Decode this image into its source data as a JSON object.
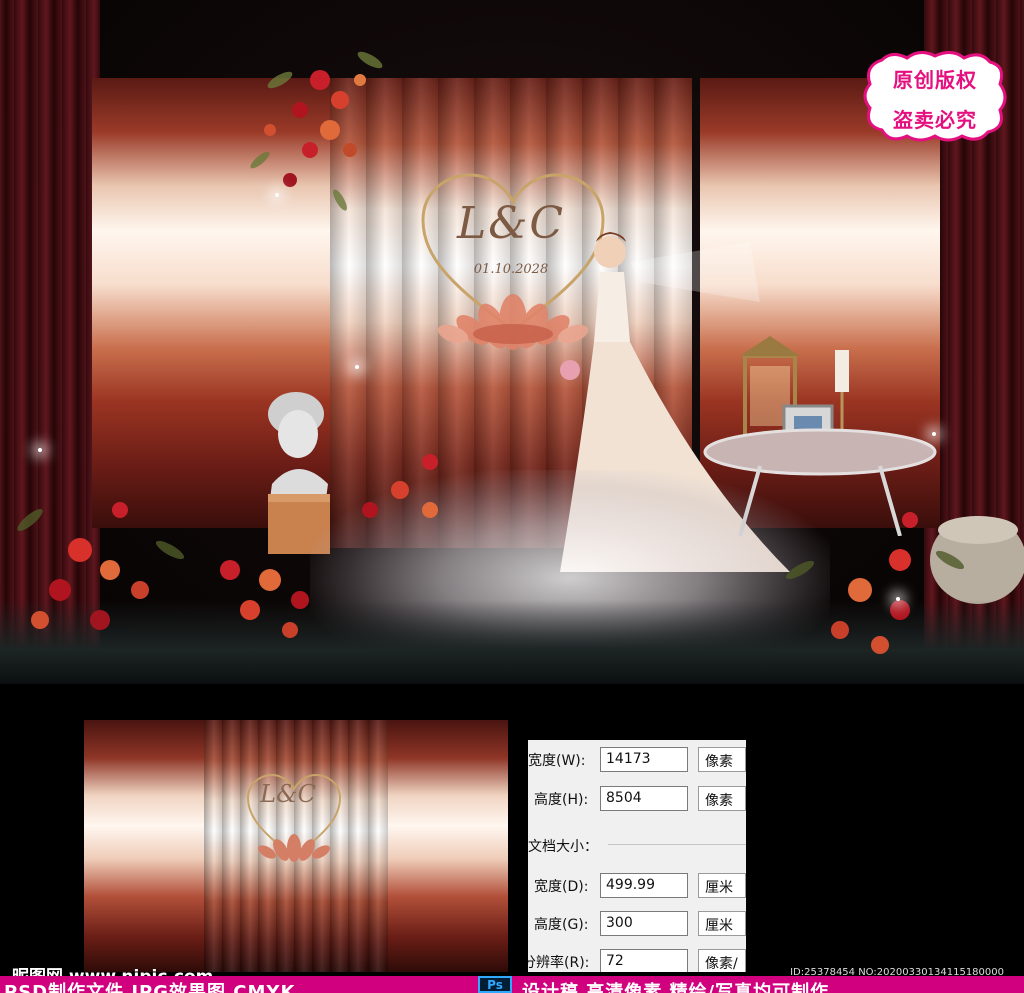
{
  "scene": {
    "monogram": "L&C",
    "date": "01.10.2028",
    "badge": {
      "line1": "原创版权",
      "line2": "盗卖必究",
      "color": "#e5107f"
    }
  },
  "thumbnail": {
    "monogram": "L&C"
  },
  "image_size_dialog": {
    "width_px": {
      "label": "宽度(W):",
      "value": "14173",
      "unit": "像素"
    },
    "height_px": {
      "label": "高度(H):",
      "value": "8504",
      "unit": "像素"
    },
    "doc_size_label": "文档大小：",
    "width_doc": {
      "label": "宽度(D):",
      "value": "499.99",
      "unit": "厘米"
    },
    "height_doc": {
      "label": "高度(G):",
      "value": "300",
      "unit": "厘米"
    },
    "resolution": {
      "label": "分辨率(R):",
      "value": "72",
      "unit": "像素/"
    }
  },
  "watermark": {
    "site": "昵图网 www.nipic.com",
    "id_text": "ID:25378454 NO:20200330134115180000"
  },
  "promo_bar": {
    "text_left": "PSD制作文件  JPG效果图  CMYK",
    "ps_icon": "Ps",
    "text_right": "设计稿  高清像素  精绘/写真均可制作",
    "color": "#d0007e"
  }
}
